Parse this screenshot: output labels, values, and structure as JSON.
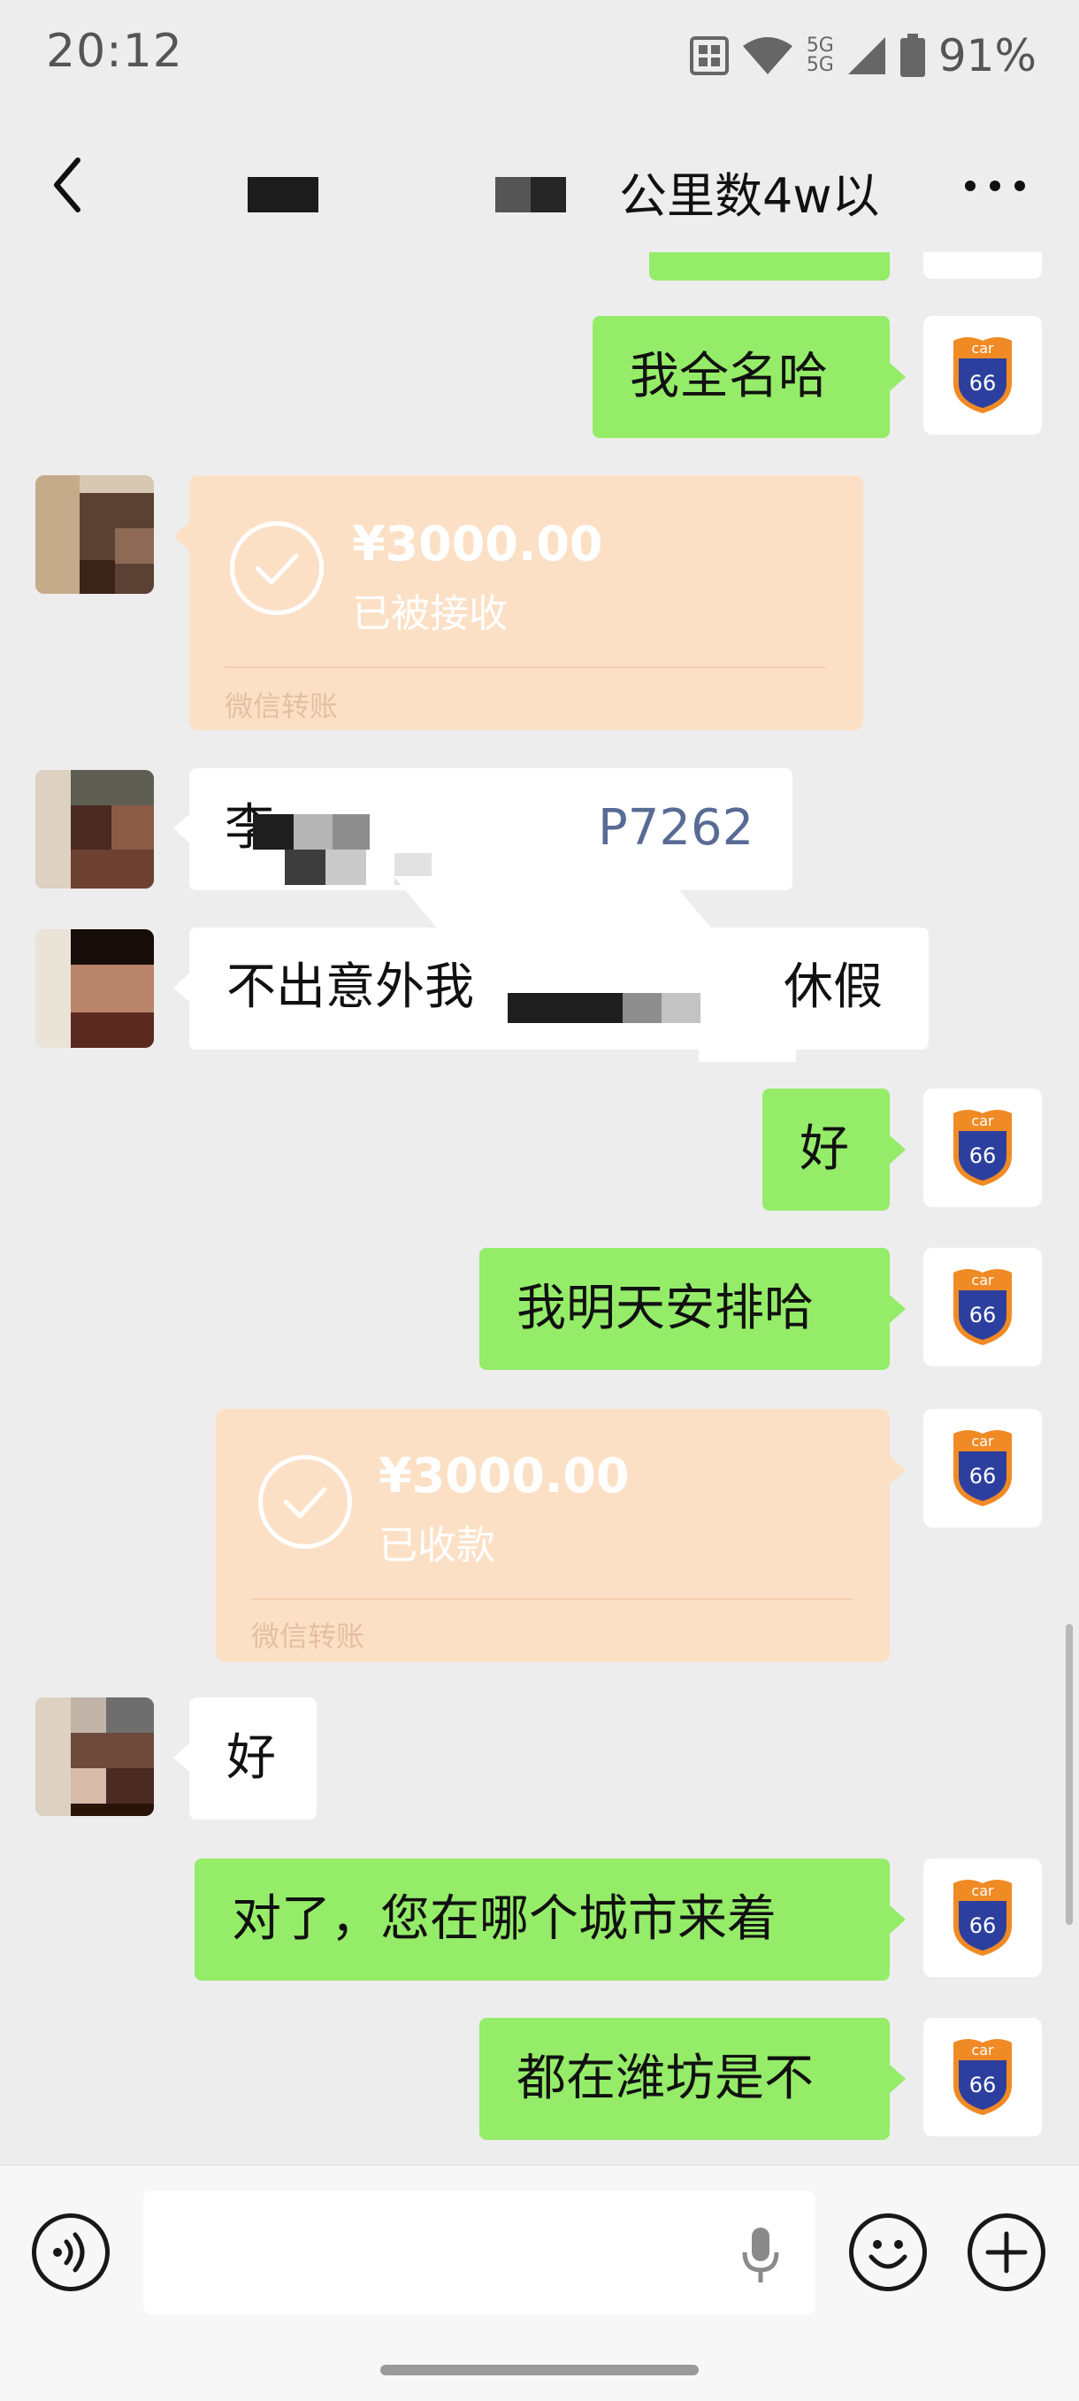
{
  "status_bar": {
    "time": "20:12",
    "network": "5G",
    "battery": "91%"
  },
  "nav": {
    "title": "公里数4w以",
    "more_label": "…"
  },
  "messages": [
    {
      "text": "我全名哈"
    },
    {
      "amount": "¥3000.00",
      "status": "已被接收",
      "label": "微信转账"
    },
    {
      "prefix": "李",
      "suffix": "P7262"
    },
    {
      "prefix": "不出意外我",
      "suffix": "休假"
    },
    {
      "text": "好"
    },
    {
      "text": "我明天安排哈"
    },
    {
      "amount": "¥3000.00",
      "status": "已收款",
      "label": "微信转账"
    },
    {
      "text": "好"
    },
    {
      "text": "对了，您在哪个城市来着"
    },
    {
      "text": "都在潍坊是不"
    }
  ],
  "avatar_badge": {
    "top_text": "car",
    "number": "66"
  },
  "colors": {
    "my_bubble": "#95ec69",
    "their_bubble": "#ffffff",
    "transfer_card": "#fce0c6",
    "background": "#ededed"
  },
  "icons": [
    "back-icon",
    "more-icon",
    "voice-mode-icon",
    "mic-icon",
    "emoji-icon",
    "plus-icon",
    "wifi-icon",
    "signal-icon",
    "battery-icon"
  ]
}
